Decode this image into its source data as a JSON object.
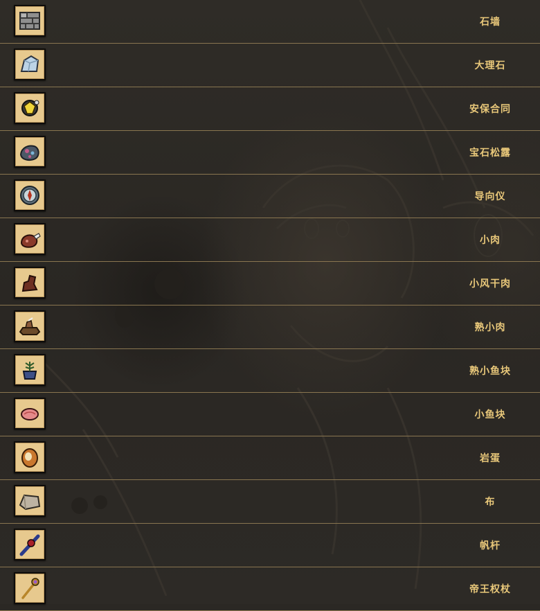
{
  "items": [
    {
      "name": "石墙",
      "icon": "stone-wall-icon"
    },
    {
      "name": "大理石",
      "icon": "marble-icon"
    },
    {
      "name": "安保合同",
      "icon": "security-contract-icon"
    },
    {
      "name": "宝石松露",
      "icon": "gem-truffle-icon"
    },
    {
      "name": "导向仪",
      "icon": "compass-icon"
    },
    {
      "name": "小肉",
      "icon": "morsel-icon"
    },
    {
      "name": "小风干肉",
      "icon": "small-jerky-icon"
    },
    {
      "name": "熟小肉",
      "icon": "cooked-morsel-icon"
    },
    {
      "name": "熟小鱼块",
      "icon": "cooked-fish-morsel-icon"
    },
    {
      "name": "小鱼块",
      "icon": "fish-morsel-icon"
    },
    {
      "name": "岩蛋",
      "icon": "rock-egg-icon"
    },
    {
      "name": "布",
      "icon": "cloth-icon"
    },
    {
      "name": "帆杆",
      "icon": "mast-icon"
    },
    {
      "name": "帝王权杖",
      "icon": "royal-scepter-icon"
    }
  ],
  "colors": {
    "background": "#2b2824",
    "divider": "#8a7650",
    "item_text": "#e9c87a",
    "icon_frame": "#e7c98e"
  }
}
